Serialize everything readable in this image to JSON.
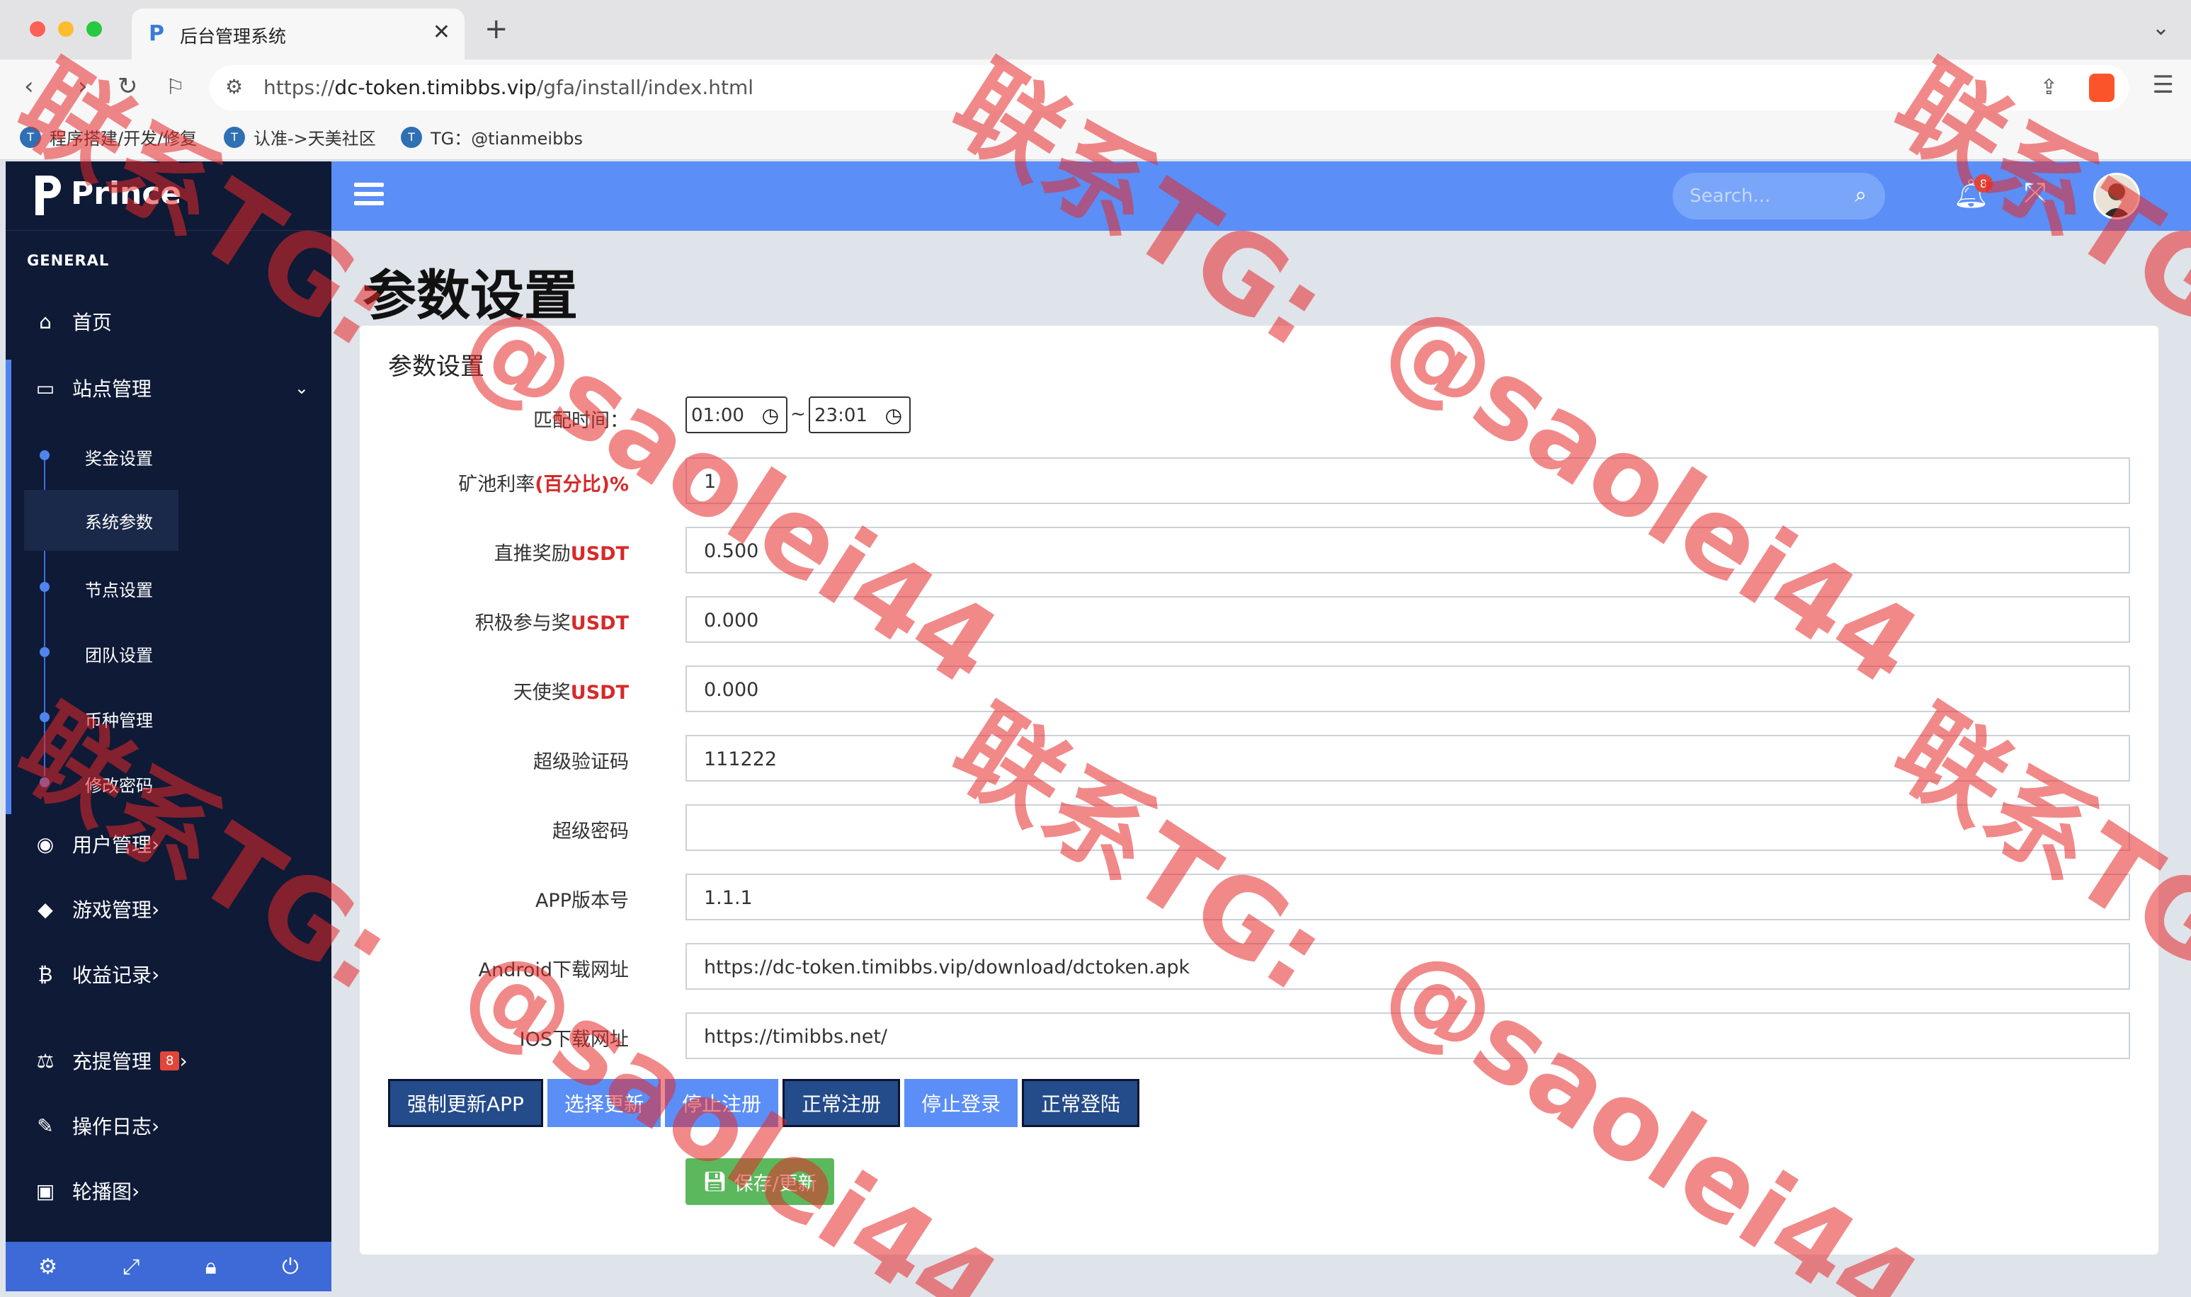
{
  "browser": {
    "tab_title": "后台管理系统",
    "tab_favicon": "P",
    "url_prefix": "https://",
    "url_domain": "dc-token.timibbs.vip",
    "url_path": "/gfa/install/index.html",
    "bookmarks": [
      {
        "label": "程序搭建/开发/修复"
      },
      {
        "label": "认准->天美社区"
      },
      {
        "label": "TG：@tianmeibbs"
      }
    ]
  },
  "sidebar": {
    "brand": "Prince",
    "section": "GENERAL",
    "items": [
      {
        "label": "首页",
        "icon": "home-icon"
      },
      {
        "label": "站点管理",
        "icon": "monitor-icon",
        "expanded": true
      },
      {
        "label": "用户管理",
        "icon": "user-circle-icon"
      },
      {
        "label": "游戏管理",
        "icon": "cube-icon"
      },
      {
        "label": "收益记录",
        "icon": "bitcoin-icon"
      },
      {
        "label": "充提管理",
        "icon": "scale-icon",
        "badge": "8"
      },
      {
        "label": "操作日志",
        "icon": "edit-icon"
      },
      {
        "label": "轮播图",
        "icon": "image-icon"
      }
    ],
    "sub_items": [
      {
        "label": "奖金设置"
      },
      {
        "label": "系统参数",
        "active": true
      },
      {
        "label": "节点设置"
      },
      {
        "label": "团队设置"
      },
      {
        "label": "币种管理"
      },
      {
        "label": "修改密码"
      }
    ],
    "footer_icons": [
      "gear-icon",
      "expand-icon",
      "lock-icon",
      "power-icon"
    ]
  },
  "topbar": {
    "search_placeholder": "Search...",
    "notification_count": "8"
  },
  "page": {
    "title": "参数设置",
    "card_title": "参数设置",
    "match_time_label": "匹配时间：",
    "match_time_start": "01:00",
    "match_time_end": "23:01",
    "tilde": "~",
    "fields": [
      {
        "label": "矿池利率",
        "label_red": "(百分比)%",
        "value": "1"
      },
      {
        "label": "直推奖励",
        "label_red": "USDT",
        "value": "0.500"
      },
      {
        "label": "积极参与奖",
        "label_red": "USDT",
        "value": "0.000"
      },
      {
        "label": "天使奖",
        "label_red": "USDT",
        "value": "0.000"
      },
      {
        "label": "超级验证码",
        "label_red": "",
        "value": "111222"
      },
      {
        "label": "超级密码",
        "label_red": "",
        "value": ""
      },
      {
        "label": "APP版本号",
        "label_red": "",
        "value": "1.1.1"
      },
      {
        "label": "Android下载网址",
        "label_red": "",
        "value": "https://dc-token.timibbs.vip/download/dctoken.apk"
      },
      {
        "label": "IOS下载网址",
        "label_red": "",
        "value": "https://timibbs.net/"
      }
    ],
    "buttons": [
      {
        "label": "强制更新APP",
        "style": "dark"
      },
      {
        "label": "选择更新",
        "style": "light"
      },
      {
        "label": "停止注册",
        "style": "light"
      },
      {
        "label": "正常注册",
        "style": "dark"
      },
      {
        "label": "停止登录",
        "style": "light"
      },
      {
        "label": "正常登陆",
        "style": "dark"
      }
    ],
    "save_label": "保存/更新"
  },
  "watermarks": {
    "line_a": "联系TG:",
    "line_b": "@saolei44"
  },
  "colors": {
    "sidebar_bg": "#0e1a36",
    "topbar": "#5b8ef6",
    "accent_red": "#d62a2a",
    "save_green": "#5cb85c",
    "watermark": "#e62828"
  }
}
